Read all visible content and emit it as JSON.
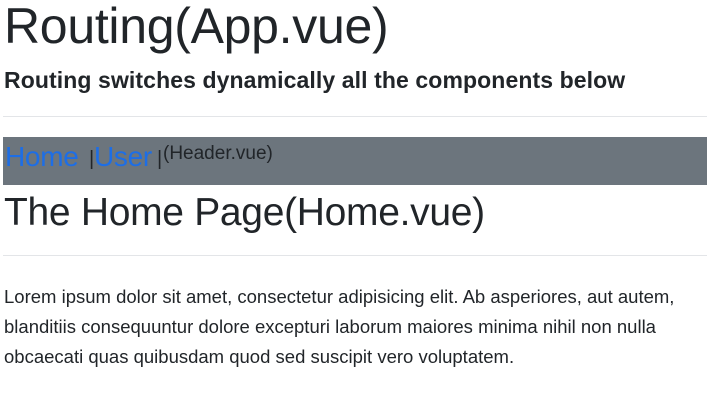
{
  "app": {
    "title": "Routing(App.vue)",
    "subtitle": "Routing switches dynamically all the components below"
  },
  "header": {
    "links": [
      {
        "label": "Home"
      },
      {
        "label": "User"
      }
    ],
    "separator": "|",
    "note": "(Header.vue)",
    "colors": {
      "bar": "#6c757d",
      "link": "#1d6ee6"
    }
  },
  "page": {
    "title": "The Home Page(Home.vue)",
    "body": "Lorem ipsum dolor sit amet, consectetur adipisicing elit. Ab asperiores, aut autem, blanditiis consequuntur dolore excepturi laborum maiores minima nihil non nulla obcaecati quas quibusdam quod sed suscipit vero voluptatem."
  }
}
